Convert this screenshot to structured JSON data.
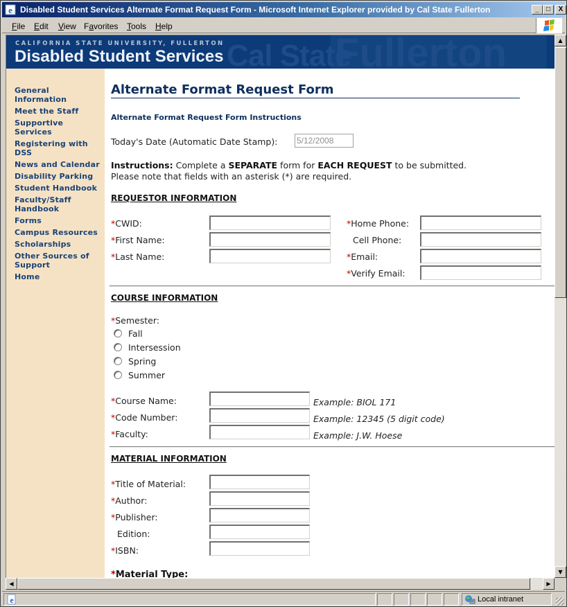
{
  "window": {
    "title": "Disabled Student Services Alternate Format Request Form - Microsoft Internet Explorer provided by Cal State Fullerton",
    "controls": {
      "minimize": "_",
      "maximize": "□",
      "close": "X"
    }
  },
  "menubar": {
    "items": [
      {
        "label": "File",
        "accel": "F",
        "rest": "ile"
      },
      {
        "label": "Edit",
        "accel": "E",
        "rest": "dit"
      },
      {
        "label": "View",
        "accel": "V",
        "rest": "iew"
      },
      {
        "label": "Favorites",
        "accel": "a",
        "pre": "F",
        "rest": "vorites"
      },
      {
        "label": "Tools",
        "accel": "T",
        "rest": "ools"
      },
      {
        "label": "Help",
        "accel": "H",
        "rest": "elp"
      }
    ]
  },
  "header": {
    "university": "CALIFORNIA STATE UNIVERSITY, FULLERTON",
    "department": "Disabled Student Services",
    "watermark_left": "Cal State",
    "watermark_right": "Fullerton",
    "colors": {
      "banner": "#0d3a78",
      "sidebar": "#f5e2c4",
      "link": "#1a4276"
    }
  },
  "sidebar": {
    "items": [
      {
        "label": "General Information"
      },
      {
        "label": "Meet the Staff"
      },
      {
        "label": "Supportive Services"
      },
      {
        "label": "Registering with DSS"
      },
      {
        "label": "News and Calendar"
      },
      {
        "label": "Disability Parking"
      },
      {
        "label": "Student Handbook"
      },
      {
        "label": "Faculty/Staff Handbook"
      },
      {
        "label": "Forms"
      },
      {
        "label": "Campus Resources"
      },
      {
        "label": "Scholarships"
      },
      {
        "label": "Other Sources of Support"
      },
      {
        "label": "Home"
      }
    ]
  },
  "form": {
    "title": "Alternate Format Request Form",
    "instructions_link": "Alternate Format Request Form Instructions",
    "date_label": "Today's Date (Automatic Date Stamp):",
    "date_value": "5/12/2008",
    "instructions": {
      "lead": "Instructions:",
      "t1": " Complete a ",
      "b1": "SEPARATE",
      "t2": " form for ",
      "b2": "EACH REQUEST",
      "t3": " to be submitted.",
      "line2": "Please note that fields with an asterisk (*) are required."
    },
    "asterisk": "*",
    "requestor": {
      "heading": "REQUESTOR INFORMATION",
      "left_fields": [
        {
          "label": "CWID:",
          "required": true,
          "value": ""
        },
        {
          "label": "First Name:",
          "required": true,
          "value": ""
        },
        {
          "label": "Last Name:",
          "required": true,
          "value": ""
        }
      ],
      "right_fields": [
        {
          "label": "Home Phone:",
          "required": true,
          "value": ""
        },
        {
          "label": "Cell Phone:",
          "required": false,
          "value": ""
        },
        {
          "label": "Email:",
          "required": true,
          "value": ""
        },
        {
          "label": "Verify Email:",
          "required": true,
          "value": ""
        }
      ]
    },
    "course": {
      "heading": "COURSE INFORMATION",
      "semester_label": "Semester:",
      "semester_options": [
        "Fall",
        "Intersession",
        "Spring",
        "Summer"
      ],
      "semester_selected": null,
      "fields": [
        {
          "label": "Course Name:",
          "required": true,
          "value": "",
          "example": "Example: BIOL 171"
        },
        {
          "label": "Code Number:",
          "required": true,
          "value": "",
          "example": "Example: 12345 (5 digit code)"
        },
        {
          "label": "Faculty:",
          "required": true,
          "value": "",
          "example": "Example: J.W. Hoese"
        }
      ]
    },
    "material": {
      "heading": "MATERIAL INFORMATION",
      "fields": [
        {
          "label": "Title of Material:",
          "required": true,
          "value": ""
        },
        {
          "label": "Author:",
          "required": true,
          "value": ""
        },
        {
          "label": "Publisher:",
          "required": true,
          "value": ""
        },
        {
          "label": "Edition:",
          "required": false,
          "value": ""
        },
        {
          "label": "ISBN:",
          "required": true,
          "value": ""
        }
      ],
      "material_type_label": "Material Type:"
    }
  },
  "statusbar": {
    "zone": "Local intranet"
  }
}
